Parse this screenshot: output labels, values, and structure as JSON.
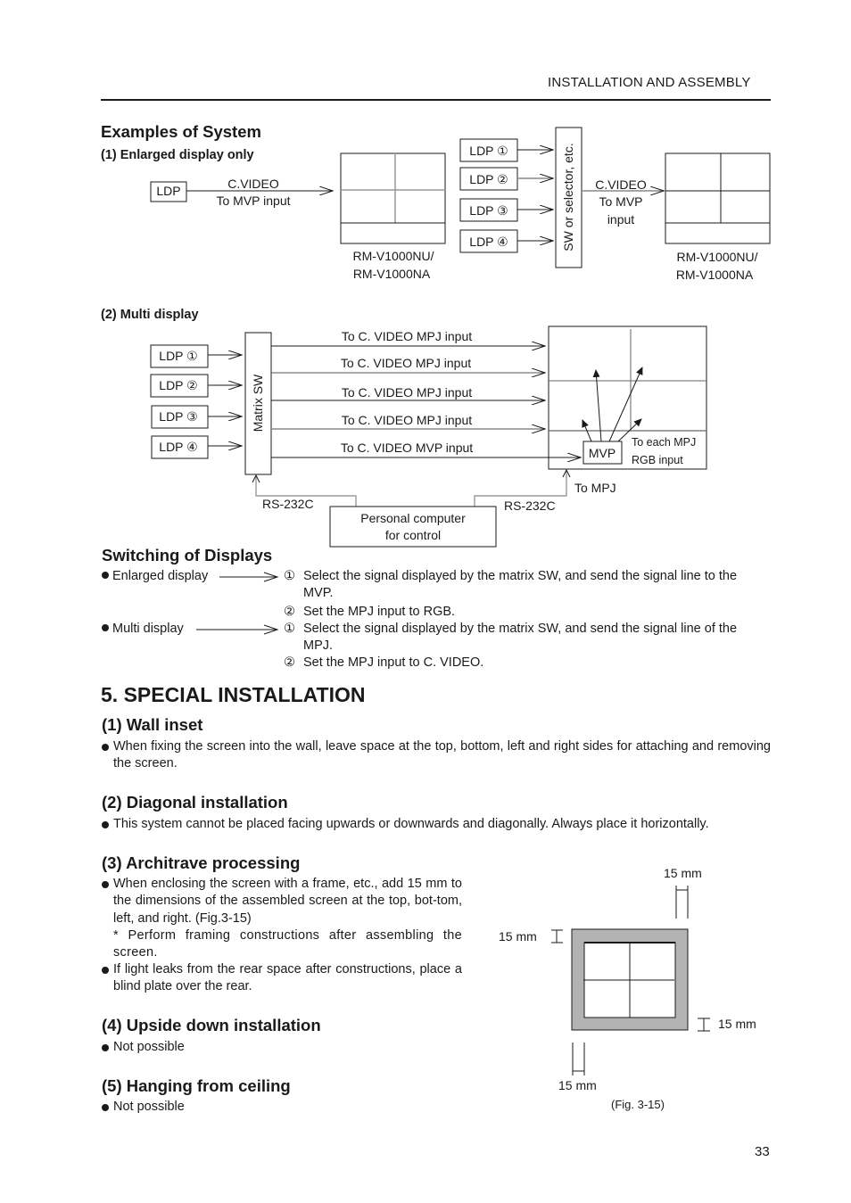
{
  "header": {
    "running_title": "INSTALLATION AND ASSEMBLY"
  },
  "examples": {
    "title": "Examples of System",
    "enlarged": {
      "subtitle": "(1) Enlarged display only",
      "ldp_label": "LDP",
      "signal_line1": "C.VIDEO",
      "signal_line2": "To MVP input",
      "screen_model_line1": "RM-V1000NU/",
      "screen_model_line2": "RM-V1000NA",
      "ldp_multi": [
        "LDP ①",
        "LDP ②",
        "LDP ③",
        "LDP ④"
      ],
      "selector_label": "SW or selector, etc.",
      "signal2_line1": "C.VIDEO",
      "signal2_line2": "To MVP",
      "signal2_line3": "input",
      "screen2_model_line1": "RM-V1000NU/",
      "screen2_model_line2": "RM-V1000NA"
    },
    "multi": {
      "subtitle": "(2) Multi display",
      "ldps": [
        "LDP ①",
        "LDP ②",
        "LDP ③",
        "LDP ④"
      ],
      "matrix_label": "Matrix SW",
      "outputs": [
        "To C. VIDEO MPJ input",
        "To C. VIDEO MPJ input",
        "To C. VIDEO MPJ input",
        "To C. VIDEO MPJ input",
        "To C. VIDEO MVP input"
      ],
      "mvp_label": "MVP",
      "mvp_note_line1": "To each MPJ",
      "mvp_note_line2": "RGB input",
      "to_mpj": "To MPJ",
      "rs232_left": "RS-232C",
      "rs232_right": "RS-232C",
      "pc_line1": "Personal computer",
      "pc_line2": "for control"
    }
  },
  "switching": {
    "title": "Switching of Displays",
    "items": [
      {
        "mode": "Enlarged display",
        "steps": [
          {
            "num": "①",
            "text_line1": "Select the signal displayed by the matrix SW, and send the signal line to the",
            "text_line2": "MVP."
          },
          {
            "num": "②",
            "text_line1": "Set the MPJ input to RGB.",
            "text_line2": ""
          }
        ]
      },
      {
        "mode": "Multi display",
        "steps": [
          {
            "num": "①",
            "text_line1": "Select the signal displayed by the matrix SW, and send the signal line of the",
            "text_line2": "MPJ."
          },
          {
            "num": "②",
            "text_line1": "Set the MPJ input to C. VIDEO.",
            "text_line2": ""
          }
        ]
      }
    ]
  },
  "special": {
    "title": "5. SPECIAL INSTALLATION",
    "wall": {
      "title": "(1) Wall inset",
      "text": "When fixing the screen into the wall, leave space at the top, bottom, left and right sides for attaching and removing the screen."
    },
    "diagonal": {
      "title": "(2) Diagonal installation",
      "text": "This system cannot be placed facing upwards or downwards and diagonally. Always place it horizontally."
    },
    "architrave": {
      "title": "(3) Architrave processing",
      "text1": "When enclosing the screen with a frame, etc., add 15 mm to the dimensions of the assembled screen at the top, bot-tom, left, and right. (Fig.3-15)",
      "note": "* Perform framing constructions after assembling the screen.",
      "text2": "If light leaks from the rear space after constructions, place a blind plate over the rear."
    },
    "upside": {
      "title": "(4) Upside down installation",
      "text": "Not possible"
    },
    "ceiling": {
      "title": "(5) Hanging from ceiling",
      "text": "Not possible"
    },
    "figure": {
      "dim_top": "15 mm",
      "dim_left": "15 mm",
      "dim_right": "15 mm",
      "dim_bottom": "15 mm",
      "caption": "(Fig. 3-15)",
      "frame_color": "#b3b3b3"
    }
  },
  "footer": {
    "page_number": "33"
  }
}
